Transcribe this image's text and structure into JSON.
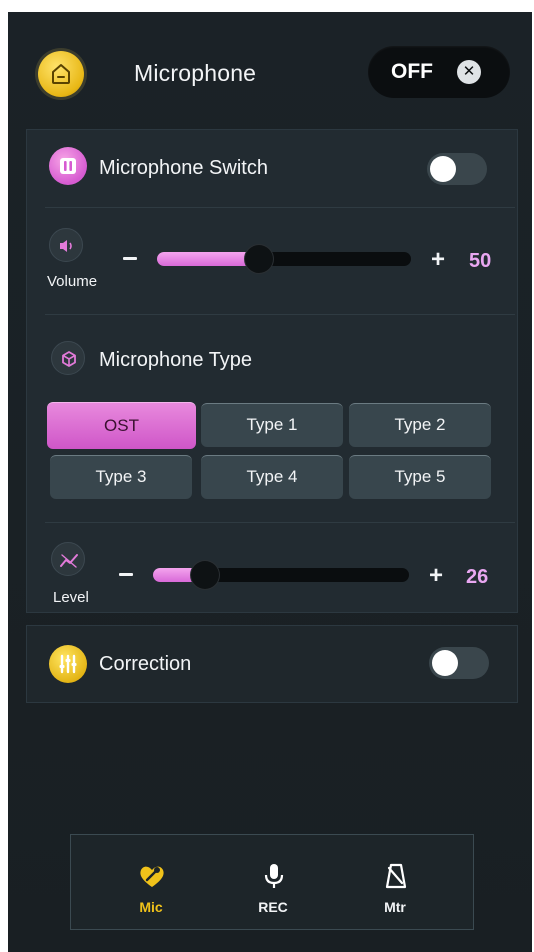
{
  "header": {
    "title": "Microphone",
    "power_toggle_label": "OFF",
    "power_toggle_state": "off"
  },
  "mic_switch": {
    "label": "Microphone Switch",
    "enabled": false
  },
  "volume": {
    "label": "Volume",
    "value": "50",
    "fraction": 0.5,
    "minus": "−",
    "plus": "+"
  },
  "mic_type": {
    "label": "Microphone Type",
    "options": [
      "OST",
      "Type 1",
      "Type 2",
      "Type 3",
      "Type 4",
      "Type 5"
    ],
    "selected": "OST"
  },
  "level": {
    "label": "Level",
    "value": "26",
    "fraction": 0.26,
    "plus": "+"
  },
  "correction": {
    "label": "Correction",
    "enabled": false
  },
  "bottom_nav": {
    "items": [
      {
        "label": "Mic",
        "icon": "mic-heart-icon",
        "active": true
      },
      {
        "label": "REC",
        "icon": "microphone-icon",
        "active": false
      },
      {
        "label": "Mtr",
        "icon": "metronome-icon",
        "active": false
      }
    ]
  },
  "colors": {
    "accent_pink": "#d86ad8",
    "accent_yellow": "#f0c21a",
    "value_text": "#e9a7f1",
    "background": "#1b2227"
  }
}
